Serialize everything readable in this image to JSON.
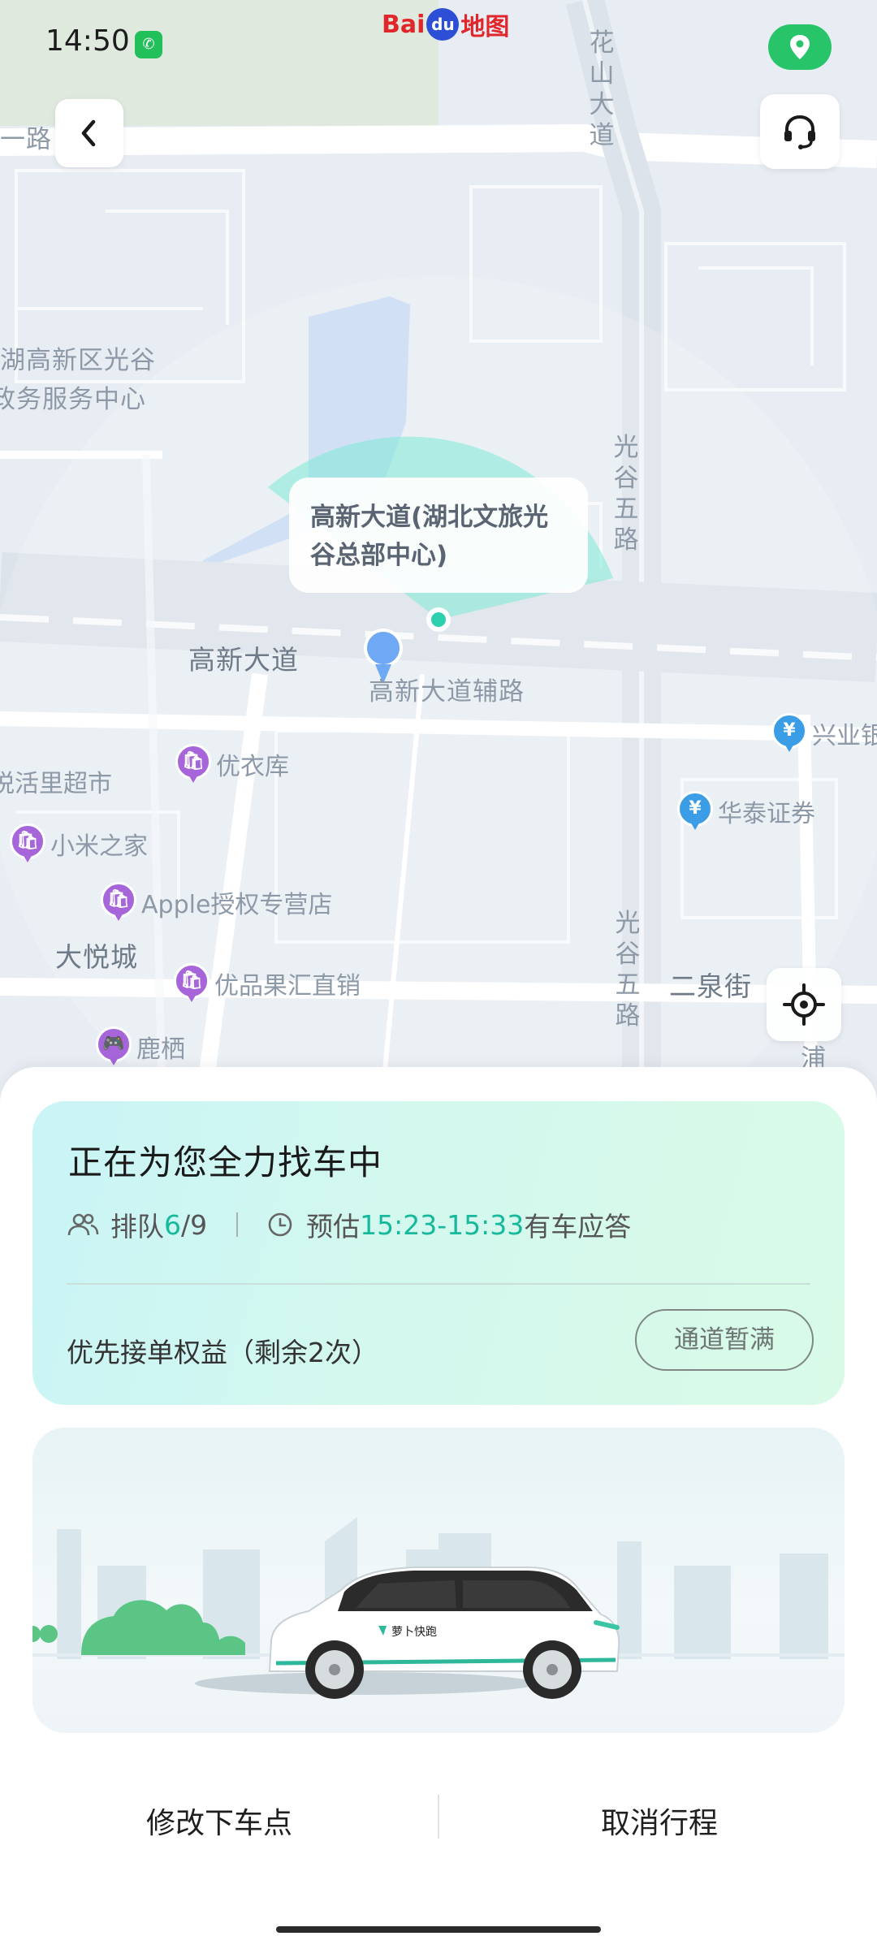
{
  "status_bar": {
    "time": "14:50"
  },
  "map": {
    "logo": {
      "text_left": "Bai",
      "text_paw": "du",
      "text_right": "地图"
    },
    "roads": {
      "top_left": "一路",
      "huashan": "花山大道",
      "guanggu5_upper": "光谷五路",
      "guanggu5_lower": "光谷五路",
      "gaoxin": "高新大道",
      "gaoxin_aux": "高新大道辅路",
      "erquan": "二泉街",
      "right_edge": "浦"
    },
    "areas": {
      "gov_line1": "湖高新区光谷",
      "gov_line2": "政务服务中心",
      "dayuecheng": "大悦城"
    },
    "pois": [
      {
        "label": "优衣库",
        "glyph": "🛍"
      },
      {
        "label": "悦活里超市",
        "glyph": ""
      },
      {
        "label": "小米之家",
        "glyph": "🛍"
      },
      {
        "label": "Apple授权专营店",
        "glyph": "🛍"
      },
      {
        "label": "优品果汇直销",
        "glyph": "🛍"
      },
      {
        "label": "鹿栖",
        "glyph": "🎮"
      }
    ],
    "finance_pois": [
      {
        "label": "兴业银",
        "glyph": "¥"
      },
      {
        "label": "华泰证券",
        "glyph": "¥"
      }
    ],
    "pickup_bubble": {
      "line1": "高新大道(湖北文旅光",
      "line2": "谷总部中心)"
    }
  },
  "icons": {
    "back": "chevron-left-icon",
    "customer_service": "headset-icon",
    "location_pill": "map-pin-icon",
    "locate": "crosshair-icon"
  },
  "status_card": {
    "title": "正在为您全力找车中",
    "queue_prefix": "排队",
    "queue_position": "6",
    "queue_total": "/9",
    "eta_prefix": "预估",
    "eta_range": "15:23-15:33",
    "eta_suffix": "有车应答",
    "priority_label": "优先接单权益（剩余2次）",
    "channel_button": "通道暂满"
  },
  "car_card": {
    "car_brand": "萝卜快跑"
  },
  "actions": {
    "modify_dropoff": "修改下车点",
    "cancel_trip": "取消行程"
  },
  "colors": {
    "accent_green": "#16b99c",
    "brand_green": "#27c46a",
    "poi_purple": "#a665d8",
    "finance_blue": "#3a9de6"
  }
}
